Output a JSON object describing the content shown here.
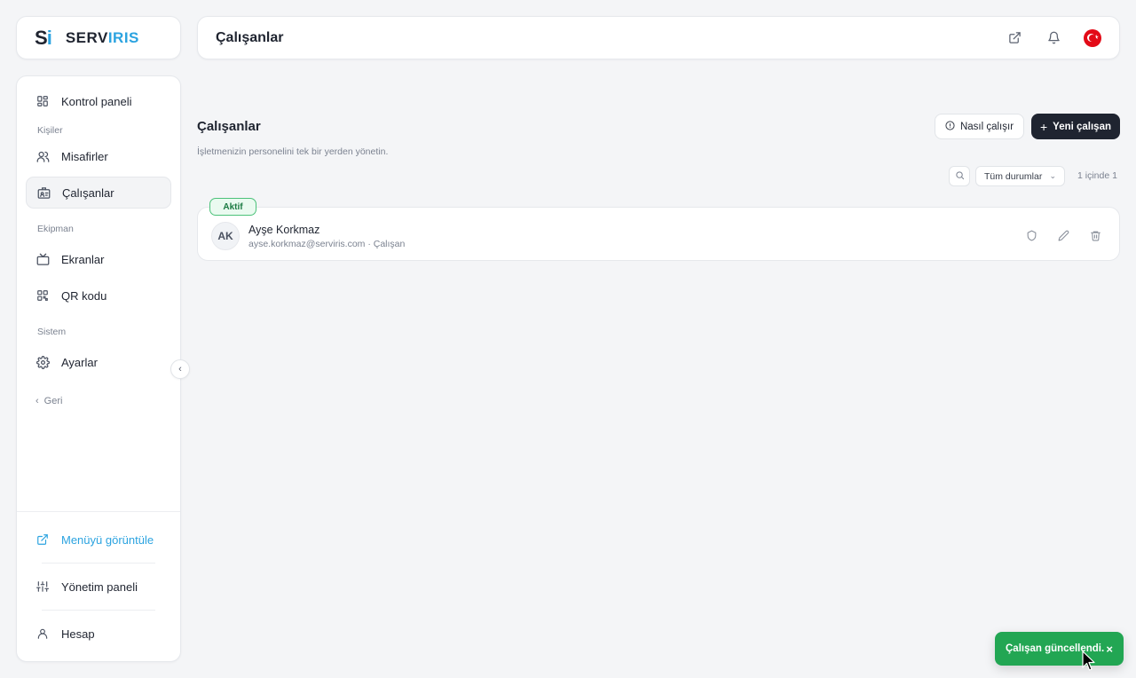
{
  "brand": {
    "mark_s": "S",
    "mark_i": "i",
    "name_a": "SERV",
    "name_b": "IRIS",
    "color_dark": "#1f2430",
    "color_blue": "#2ba3e0"
  },
  "header": {
    "title": "Çalışanlar",
    "icons": [
      "external-link-icon",
      "bell-icon",
      "turkey-flag-icon"
    ]
  },
  "sidebar": {
    "dashboard": "Kontrol paneli",
    "sections": {
      "people": "Kişiler",
      "equipment": "Ekipman",
      "system": "Sistem"
    },
    "guests": "Misafirler",
    "employees": "Çalışanlar",
    "screens": "Ekranlar",
    "qr": "QR kodu",
    "settings": "Ayarlar",
    "back": "Geri",
    "view_menu": "Menüyü görüntüle",
    "admin_panel": "Yönetim paneli",
    "account": "Hesap"
  },
  "main": {
    "title": "Çalışanlar",
    "subtitle": "İşletmenizin personelini tek bir yerden yönetin.",
    "help_button": "Nasıl çalışır",
    "new_button": "Yeni çalışan",
    "filter_selected": "Tüm durumlar",
    "count": "1 içinde 1"
  },
  "employees": [
    {
      "initials": "AK",
      "name": "Ayşe Korkmaz",
      "meta": "ayse.korkmaz@serviris.com · Çalışan",
      "status": "Aktif",
      "status_color": "#22a653"
    }
  ],
  "toast": {
    "message": "Çalışan güncellendi.",
    "color": "#22a653"
  }
}
